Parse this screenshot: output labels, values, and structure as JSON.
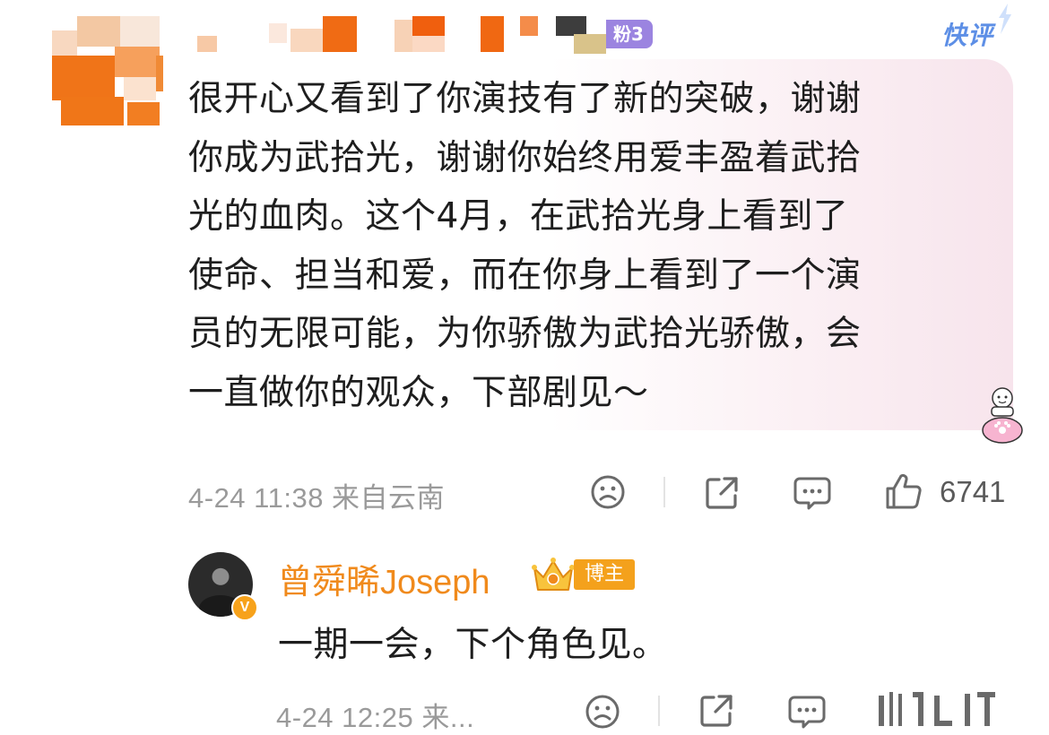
{
  "comment": {
    "fan_badge": "粉3",
    "quick_comment_label": "快评",
    "text": "很开心又看到了你演技有了新的突破，谢谢\n你成为武拾光，谢谢你始终用爱丰盈着武拾\n光的血肉。这个4月，在武拾光身上看到了\n使命、担当和爱，而在你身上看到了一个演\n员的无限可能，为你骄傲为武拾光骄傲，会\n一直做你的观众，下部剧见～",
    "meta": "4-24 11:38 来自云南",
    "like_count": "6741"
  },
  "reply": {
    "author": "曾舜晞Joseph",
    "verified_badge": "V",
    "host_badge": "博主",
    "text": "一期一会，下个角色见。",
    "meta": "4-24 12:25 来..."
  },
  "icons": [
    "pixelated-avatar",
    "sad-face-icon",
    "share-icon",
    "comment-icon",
    "thumbs-up-icon",
    "crown-icon",
    "sticker-icon"
  ],
  "colors": {
    "name_orange": "#f08a1c",
    "quick_blue": "#5d8fe6",
    "fan_badge_purple": "#9b84e0",
    "host_badge_orange": "#f4a11c",
    "meta_gray": "#9a9a9a"
  }
}
